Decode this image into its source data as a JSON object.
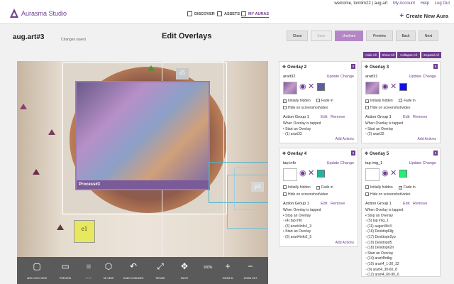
{
  "header": {
    "brand": "Aurasma Studio",
    "welcome": "welcome, tomlim22 | aug.art",
    "my_account": "My Account",
    "help": "Help",
    "logout": "Log Out",
    "nav": [
      "DISCOVER",
      "ASSETS",
      "MY AURAS"
    ],
    "create": "Create New Aura"
  },
  "page": {
    "aura_name": "aug.art#3",
    "save_status": "Changes saved",
    "title": "Edit Overlays",
    "buttons": [
      "Close",
      "Save",
      "Unshare",
      "Preview",
      "Back",
      "Next"
    ],
    "panel_actions": [
      "Hide All",
      "Show All",
      "Collapse All",
      "Expand All"
    ]
  },
  "canvas": {
    "overlay_label": "Process#3",
    "tag_d5": "d5",
    "tag_e1": "e1",
    "tag_p3": "p3"
  },
  "toolbar": {
    "tools": [
      {
        "label": "ADD LOCK VIEW",
        "icon": "lock-view-icon",
        "glyph": "▢",
        "enabled": true
      },
      {
        "label": "PREVIEW",
        "icon": "preview-icon",
        "glyph": "▭",
        "enabled": true
      },
      {
        "label": "STOP",
        "icon": "stop-icon",
        "glyph": "■",
        "enabled": false
      },
      {
        "label": "3D VIEW",
        "icon": "cube-icon",
        "glyph": "⬡",
        "enabled": true
      },
      {
        "label": "UNDO CHANGES",
        "icon": "undo-icon",
        "glyph": "↶",
        "enabled": true
      },
      {
        "label": "RESIZE",
        "icon": "resize-icon",
        "glyph": "⤢",
        "enabled": true
      },
      {
        "label": "MOVE",
        "icon": "move-icon",
        "glyph": "✥",
        "enabled": true
      },
      {
        "label": "100%",
        "icon": "zoom-level",
        "glyph": "",
        "enabled": true
      },
      {
        "label": "ZOOM IN",
        "icon": "zoom-in-icon",
        "glyph": "+",
        "enabled": true
      },
      {
        "label": "ZOOM OUT",
        "icon": "zoom-out-icon",
        "glyph": "−",
        "enabled": true
      }
    ]
  },
  "overlays": [
    {
      "title": "Overlay 2",
      "badge": "8",
      "name": "arart32",
      "update": "Update Change",
      "swatch": "#5d5f9e",
      "initially_hidden": "Initially hidden",
      "initially_hidden_checked": true,
      "fade_in": "Fade in",
      "fade_in_checked": false,
      "hide_on_screenshot": "Hide on screenshot/video",
      "action_group": "Action Group 1",
      "edit": "Edit",
      "remove": "Remove",
      "lines": [
        "When Overlay is tapped",
        "• Start an Overlay",
        "  ◦ (1) arart33"
      ],
      "add_actions": "Add Actions"
    },
    {
      "title": "Overlay 3",
      "badge": "8",
      "name": "arart31",
      "update": "Update Change",
      "swatch": "#1111ee",
      "initially_hidden": "Initially hidden",
      "initially_hidden_checked": true,
      "fade_in": "Fade in",
      "fade_in_checked": false,
      "hide_on_screenshot": "Hide on screenshot/video",
      "action_group": "Action Group 1",
      "edit": "Edit",
      "remove": "Remove",
      "lines": [
        "When Overlay is tapped",
        "• Start an Overlay",
        "  ◦ (2) arart32"
      ],
      "add_actions": "Add Actions"
    },
    {
      "title": "Overlay 4",
      "badge": "8",
      "name": "tap info",
      "update": "Update Change",
      "swatch": "#1fb5a0",
      "initially_hidden": "Initially hidden",
      "initially_hidden_checked": false,
      "fade_in": "Fade in",
      "fade_in_checked": true,
      "hide_on_screenshot": "Hide on screenshot/video",
      "action_group": "Action Group 1",
      "edit": "Edit",
      "remove": "Remove",
      "lines": [
        "When Overlay is tapped",
        "• Stop an Overlay",
        "  ◦ (4) tap info",
        "  ◦ (3) arart4info1_3",
        "• Start an Overlay",
        "  ◦ (6) arart4info2_5"
      ],
      "add_actions": "Add Actions"
    },
    {
      "title": "Overlay 5",
      "badge": "8",
      "name": "tap img_1",
      "update": "Update Change",
      "swatch": "#22ee77",
      "initially_hidden": "Initially hidden",
      "initially_hidden_checked": false,
      "fade_in": "Fade in",
      "fade_in_checked": true,
      "hide_on_screenshot": "Hide on screenshot/video",
      "action_group": "Action Group 1",
      "edit": "Edit",
      "remove": "Remove",
      "lines": [
        "When Overlay is tapped",
        "• Stop an Overlay",
        "  ◦ (5) tap img_1",
        "  ◦ (11) augart3fo3",
        "  ◦ (16) Desktop6llg",
        "  ◦ (17) Desktope2yp",
        "  ◦ (19) Desktopd5",
        "  ◦ (18) Desktop62n",
        "• Start an Overlay",
        "  ◦ (14) arart4fotbg",
        "  ◦ (10) arart4_1-30_32",
        "  ◦ (9) arart4_30-60_8",
        "  ◦ (12) arart4_60-90_6"
      ],
      "add_actions": ""
    }
  ]
}
